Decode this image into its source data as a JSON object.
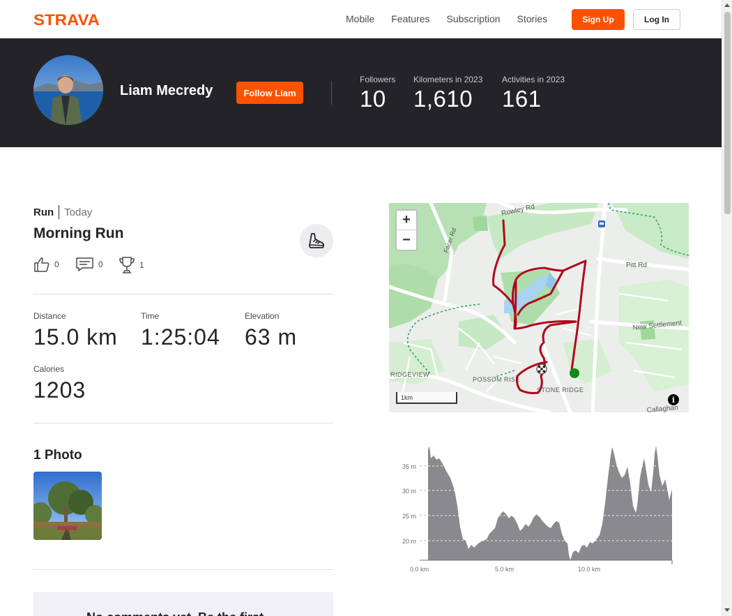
{
  "nav": {
    "brand": "STRAVA",
    "links": [
      "Mobile",
      "Features",
      "Subscription",
      "Stories"
    ],
    "signup": "Sign Up",
    "login": "Log In"
  },
  "athlete": {
    "name": "Liam Mecredy",
    "follow": "Follow Liam",
    "stats": [
      {
        "label": "Followers",
        "value": "10"
      },
      {
        "label": "Kilometers in 2023",
        "value": "1,610"
      },
      {
        "label": "Activities in 2023",
        "value": "161"
      }
    ]
  },
  "activity": {
    "sport": "Run",
    "date": "Today",
    "title": "Morning Run",
    "kudos": "0",
    "comments": "0",
    "achievements": "1",
    "metrics": [
      {
        "label": "Distance",
        "value": "15.0 km"
      },
      {
        "label": "Time",
        "value": "1:25:04"
      },
      {
        "label": "Elevation",
        "value": "63 m"
      }
    ],
    "calories_label": "Calories",
    "calories_value": "1203",
    "photos_title": "1 Photo",
    "no_comments": "No comments yet. Be the first"
  },
  "map": {
    "zoom_in": "+",
    "zoom_out": "−",
    "scale": "1km",
    "labels": [
      "Rowley Rd",
      "Facer Rd",
      "Pitt Rd",
      "New Settlement",
      "RIDGEVIEW",
      "POSSUM RISE",
      "STONE RIDGE",
      "Callaghan"
    ],
    "info": "i"
  },
  "elevation": {
    "y_ticks": [
      "35 m",
      "30 m",
      "25 m",
      "20 m"
    ],
    "x_ticks": [
      "0.0 km",
      "5.0 km",
      "10.0 km"
    ]
  },
  "colors": {
    "brand": "#fc5200",
    "header_bg": "#242428",
    "route": "#c8001b",
    "start": "#118c11"
  }
}
